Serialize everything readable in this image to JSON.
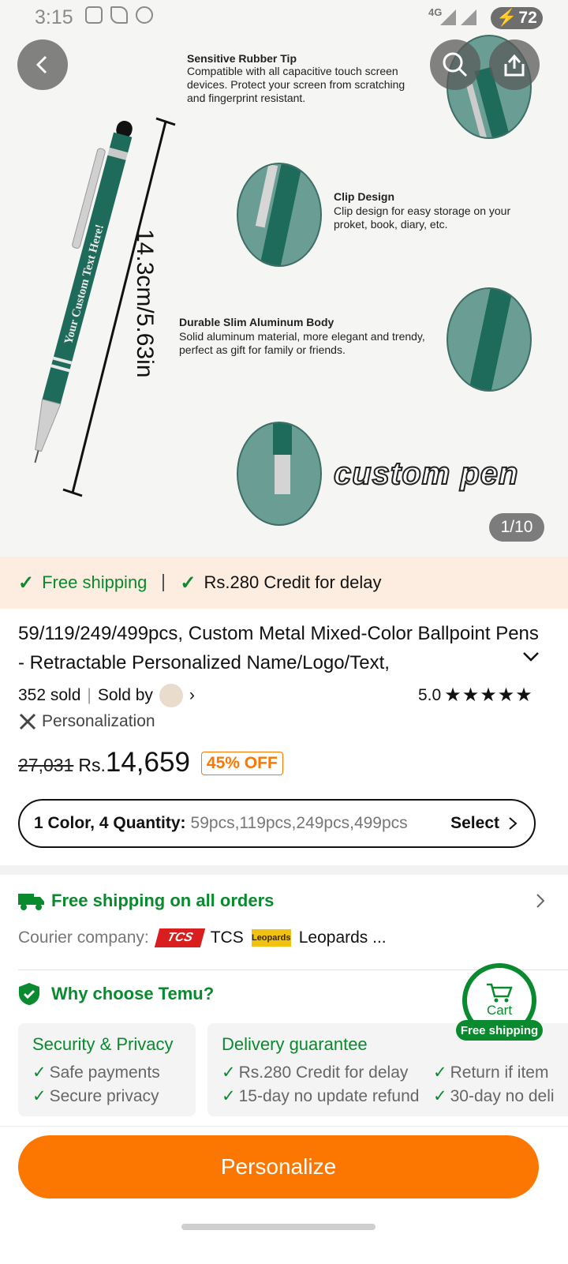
{
  "status_bar": {
    "time": "3:15",
    "network": "4G",
    "battery": "72"
  },
  "hero": {
    "features": [
      {
        "title": "Sensitive Rubber Tip",
        "text": "Compatible with all capacitive touch screen devices. Protect your screen from scratching and fingerprint resistant."
      },
      {
        "title": "Clip Design",
        "text": "Clip design for easy storage on your proket, book, diary, etc."
      },
      {
        "title": "Durable Slim Aluminum Body",
        "text": "Solid aluminum material, more elegant and trendy, perfect as gift for family or friends."
      }
    ],
    "dimension": "14.3cm/5.63in",
    "pen_text": "Your Custom Text Here!",
    "watermark": "custom pen",
    "pager": "1/10",
    "pen_color": "#1e6b5b"
  },
  "shipping_banner": {
    "free_shipping": "Free shipping",
    "credit": "Rs.280 Credit for delay"
  },
  "product": {
    "title": "59/119/249/499pcs, Custom Metal Mixed-Color Ballpoint Pens - Retractable Personalized Name/Logo/Text,",
    "sold": "352 sold",
    "sold_by": "Sold by",
    "rating": "5.0",
    "stars": "★★★★★",
    "personalization": "Personalization",
    "old_price": "27,031",
    "currency": "Rs.",
    "price": "14,659",
    "discount": "45% OFF"
  },
  "variant": {
    "label": "1 Color, 4 Quantity:",
    "values": "59pcs,119pcs,249pcs,499pcs",
    "select": "Select"
  },
  "shipping": {
    "title": "Free shipping on all orders",
    "courier_label": "Courier company:",
    "courier_1": "TCS",
    "courier_2": "Leopards ...",
    "tcs_logo": "TCS",
    "leo_logo": "Leopards"
  },
  "why": {
    "title": "Why choose Temu?",
    "security": {
      "title": "Security & Privacy",
      "items": [
        "Safe payments",
        "Secure privacy"
      ]
    },
    "delivery": {
      "title": "Delivery guarantee",
      "items": [
        "Rs.280 Credit for delay",
        "15-day no update refund",
        "Return if item",
        "30-day no deli"
      ]
    }
  },
  "cart": {
    "label": "Cart",
    "tag": "Free shipping"
  },
  "cta": {
    "label": "Personalize"
  },
  "colors": {
    "green": "#0a8a2e",
    "orange": "#fb7701"
  }
}
